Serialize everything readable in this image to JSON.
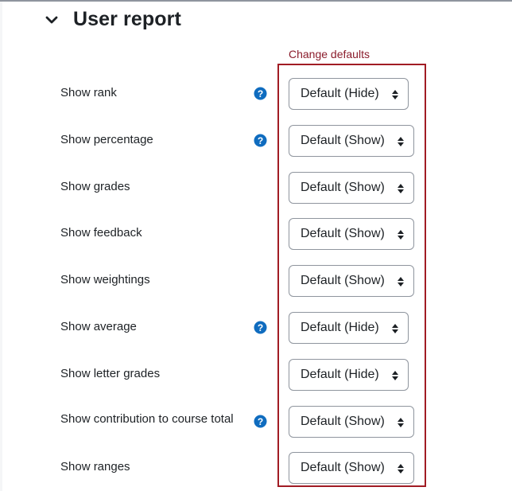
{
  "section": {
    "title": "User report",
    "toggle_icon": "chevron-down-icon"
  },
  "change_defaults_label": "Change defaults",
  "colors": {
    "link": "#8b1d2c",
    "help_icon": "#0f6cbf",
    "highlight_border": "#a11c24"
  },
  "settings": [
    {
      "label": "Show rank",
      "has_help": true,
      "value": "Default (Hide)"
    },
    {
      "label": "Show percentage",
      "has_help": true,
      "value": "Default (Show)"
    },
    {
      "label": "Show grades",
      "has_help": false,
      "value": "Default (Show)"
    },
    {
      "label": "Show feedback",
      "has_help": false,
      "value": "Default (Show)"
    },
    {
      "label": "Show weightings",
      "has_help": false,
      "value": "Default (Show)"
    },
    {
      "label": "Show average",
      "has_help": true,
      "value": "Default (Hide)"
    },
    {
      "label": "Show letter grades",
      "has_help": false,
      "value": "Default (Hide)"
    },
    {
      "label": "Show contribution to course total",
      "has_help": true,
      "value": "Default (Show)"
    },
    {
      "label": "Show ranges",
      "has_help": false,
      "value": "Default (Show)"
    }
  ]
}
